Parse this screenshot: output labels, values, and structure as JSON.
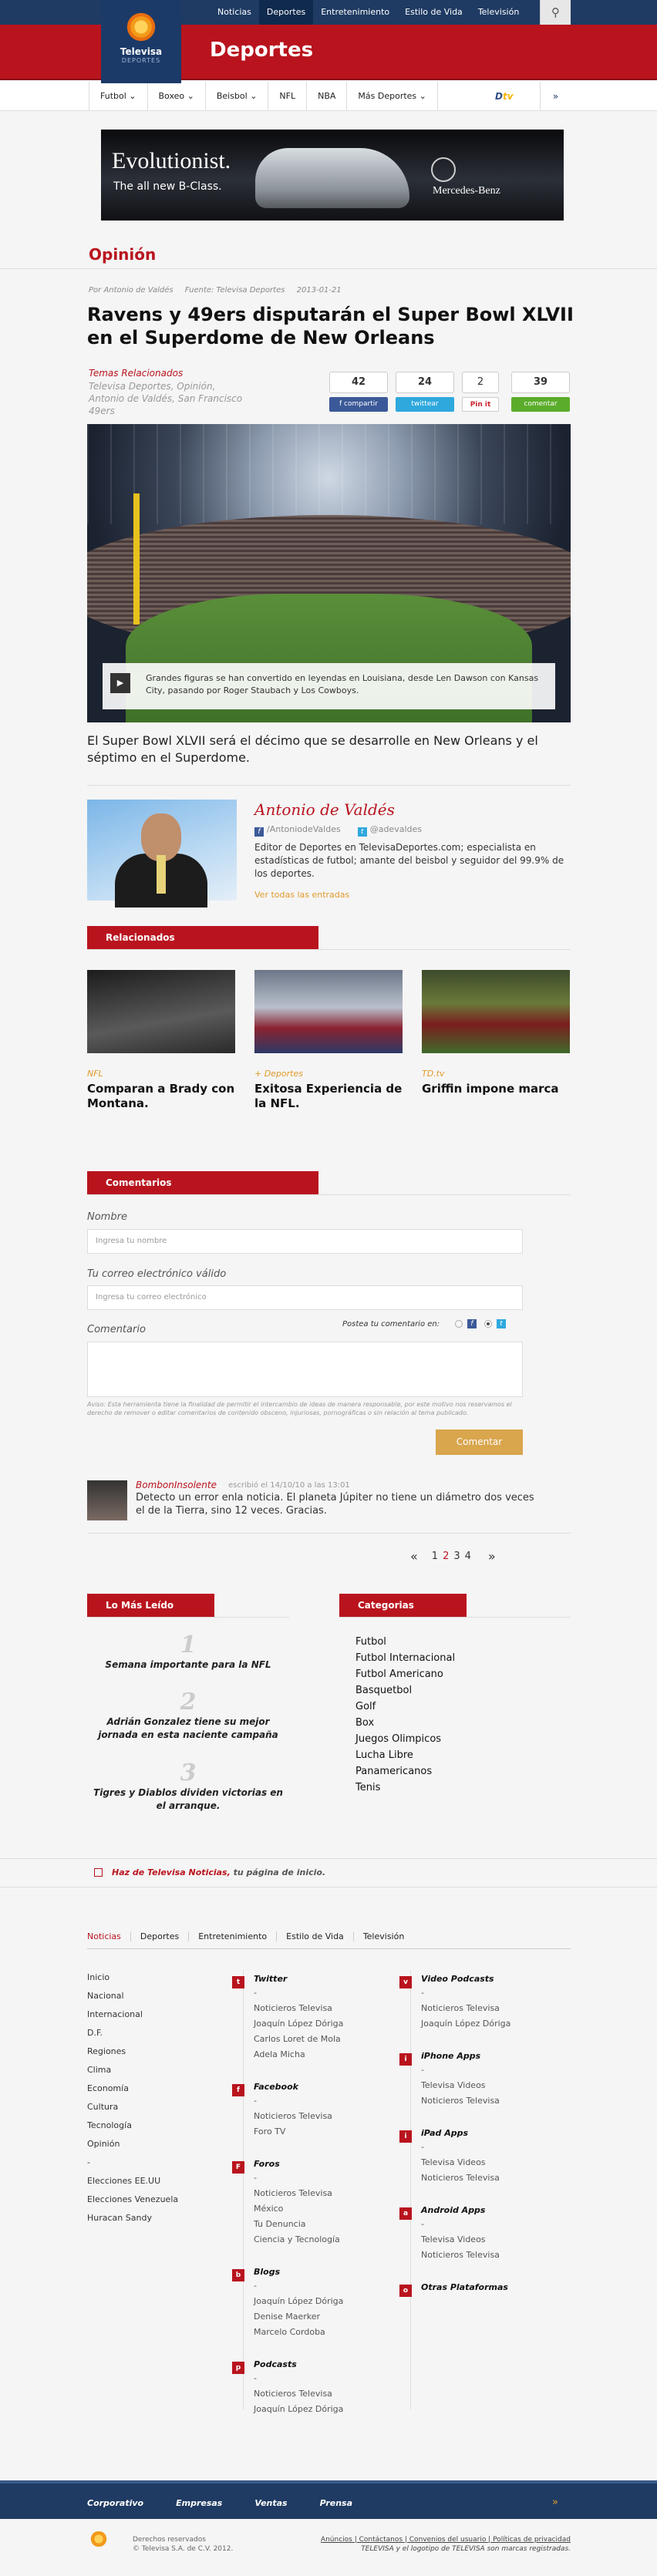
{
  "topnav": {
    "items": [
      {
        "label": "Noticias"
      },
      {
        "label": "Deportes",
        "active": true
      },
      {
        "label": "Entretenimiento"
      },
      {
        "label": "Estilo de Vida"
      },
      {
        "label": "Televisión"
      }
    ]
  },
  "logo": {
    "name": "Televisa",
    "sub": "DEPORTES"
  },
  "section_title": "Deportes",
  "subnav": {
    "items": [
      "Futbol ⌄",
      "Boxeo ⌄",
      "Beisbol ⌄",
      "NFL",
      "NBA",
      "Más Deportes ⌄"
    ],
    "dtv": "D",
    "dtv_b": "tv"
  },
  "ad": {
    "headline": "Evolutionist.",
    "sub": "The all new B-Class.",
    "brand": "Mercedes-Benz"
  },
  "opinion": "Opinión",
  "meta": {
    "author": "Por Antonio de Valdés",
    "source": "Fuente: Televisa Deportes",
    "date": "2013-01-21"
  },
  "headline": "Ravens y 49ers disputarán el Super Bowl XLVII en el Superdome de New Orleans",
  "temas": {
    "title": "Temas Relacionados",
    "text": "Televisa Deportes, Opinión, Antonio de Valdés, San Francisco 49ers"
  },
  "share": [
    {
      "count": "42",
      "label": "f compartir",
      "color": "#3b5998"
    },
    {
      "count": "24",
      "label": "twittear",
      "color": "#2ea8dd"
    },
    {
      "count": "2",
      "label": "Pin it",
      "color": "#ffffff"
    },
    {
      "count": "39",
      "label": "comentar",
      "color": "#5bac2a"
    }
  ],
  "hero": {
    "caption": "Grandes figuras se han convertido en leyendas en Louisiana, desde Len Dawson con Kansas City, pasando por Roger Staubach y Los Cowboys.",
    "play": "▶"
  },
  "lead": "El Super Bowl XLVII será el décimo que se desarrolle en New Orleans y el séptimo en el Superdome.",
  "author": {
    "name": "Antonio de Valdés",
    "facebook": "/AntoniodeValdes",
    "twitter": "@adevaldes",
    "bio": "Editor de Deportes en TelevisaDeportes.com; especialista en estadísticas de futbol; amante del beisbol y seguidor del 99.9% de los deportes.",
    "more": "Ver todas las entradas"
  },
  "related": {
    "title": "Relacionados",
    "cards": [
      {
        "cat": "NFL",
        "title": "Comparan a Brady con Montana."
      },
      {
        "cat": "+ Deportes",
        "title": "Exitosa Experiencia de la NFL."
      },
      {
        "cat": "TD.tv",
        "title": "Griffin impone marca"
      }
    ]
  },
  "comments": {
    "title": "Comentarios",
    "name_label": "Nombre",
    "name_ph": "Ingresa tu nombre",
    "email_label": "Tu correo electrónico válido",
    "email_ph": "Ingresa tu correo electrónico",
    "comment_label": "Comentario",
    "post_on": "Postea tu comentario en:",
    "disclaimer": "Aviso: Esta herramienta tiene la finalidad de permitir el intercambio de ideas de manera responsable, por este motivo nos reservamos el derecho de remover o editar comentarios de contenido obsceno, injuriosas, pornográficas o sin relación al tema publicado.",
    "submit": "Comentar",
    "item": {
      "user": "BombonInsolente",
      "meta": "escribió el 14/10/10 a las 13:01",
      "text": "Detecto un error enla noticia. El planeta Júpiter no tiene un diámetro dos veces el de la Tierra, sino 12 veces. Gracias."
    },
    "pager": {
      "prev": "«",
      "pages": [
        "1",
        "2",
        "3",
        "4"
      ],
      "current": "2",
      "next": "»"
    }
  },
  "most_read": {
    "title": "Lo Más Leído",
    "items": [
      {
        "n": "1",
        "text": "Semana importante para la NFL"
      },
      {
        "n": "2",
        "text": "Adrián Gonzalez tiene su mejor jornada en esta naciente campaña"
      },
      {
        "n": "3",
        "text": "Tigres y Diablos dividen victorias en el arranque."
      }
    ]
  },
  "categories": {
    "title": "Categorias",
    "items": [
      "Futbol",
      "Futbol Internacional",
      "Futbol Americano",
      "Basquetbol",
      "Golf",
      "Box",
      "Juegos Olimpicos",
      "Lucha Libre",
      "Panamericanos",
      "Tenis"
    ]
  },
  "home": {
    "link": "Haz de Televisa Noticias,",
    "rest": " tu página de inicio."
  },
  "footer": {
    "tabs": [
      "Noticias",
      "Deportes",
      "Entretenimiento",
      "Estilo de Vida",
      "Televisión"
    ],
    "col1": [
      "Inicio",
      "Nacional",
      "Internacional",
      "D.F.",
      "Regiones",
      "Clima",
      "Economía",
      "Cultura",
      "Tecnología",
      "Opinión",
      "-",
      "Elecciones EE.UU",
      "Elecciones Venezuela",
      "Huracan Sandy"
    ],
    "col2": [
      {
        "title": "Twitter",
        "icon": "t",
        "items": [
          "-",
          "Noticieros Televisa",
          "Joaquín López Dóriga",
          "Carlos Loret de Mola",
          "Adela Micha"
        ]
      },
      {
        "title": "Facebook",
        "icon": "f",
        "items": [
          "-",
          "Noticieros Televisa",
          "Foro TV"
        ]
      },
      {
        "title": "Foros",
        "icon": "F",
        "items": [
          "-",
          "Noticieros Televisa",
          "México",
          "Tu Denuncia",
          "Ciencia y Tecnología"
        ]
      },
      {
        "title": "Blogs",
        "icon": "b",
        "items": [
          "-",
          "Joaquín López Dóriga",
          "Denise Maerker",
          "Marcelo Cordoba"
        ]
      },
      {
        "title": "Podcasts",
        "icon": "p",
        "items": [
          "-",
          "Noticieros Televisa",
          "Joaquín López Dóriga"
        ]
      }
    ],
    "col3": [
      {
        "title": "Video Podcasts",
        "icon": "v",
        "items": [
          "-",
          "Noticieros Televisa",
          "Joaquín López Dóriga"
        ]
      },
      {
        "title": "iPhone Apps",
        "icon": "i",
        "items": [
          "-",
          "Televisa Videos",
          "Noticieros Televisa"
        ]
      },
      {
        "title": "iPad Apps",
        "icon": "i",
        "items": [
          "-",
          "Televisa Videos",
          "Noticieros Televisa"
        ]
      },
      {
        "title": "Android Apps",
        "icon": "a",
        "items": [
          "-",
          "Televisa Videos",
          "Noticieros Televisa"
        ]
      },
      {
        "title": "Otras Plataformas",
        "icon": "o",
        "items": []
      }
    ],
    "bar": [
      "Corporativo",
      "Empresas",
      "Ventas",
      "Prensa"
    ],
    "bar_arrow": "»",
    "rights1": "Derechos reservados",
    "rights2": "© Televisa S.A. de C.V. 2012.",
    "legal_links": "Anúncios | Contáctanos | Convenios del usuario | Políticas de privacidad",
    "legal_text": "TELEVISA y el logotipo de TELEVISA son marcas registradas."
  }
}
